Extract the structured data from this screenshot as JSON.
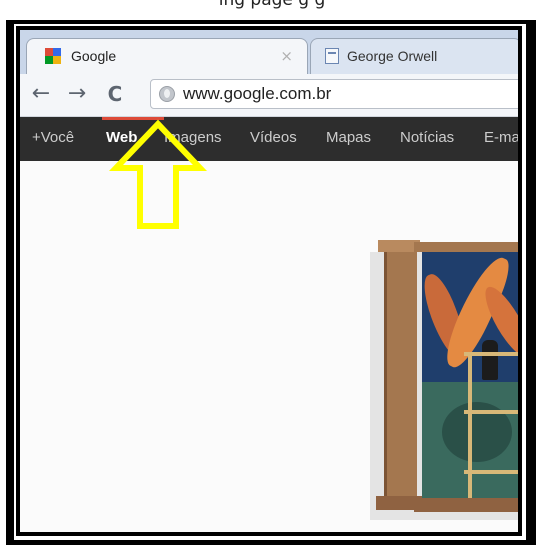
{
  "caption": {
    "text": "ing   page   g   g"
  },
  "browser": {
    "tabs": [
      {
        "title": "Google",
        "active": true,
        "icon": "google-favicon",
        "close": "×"
      },
      {
        "title": "George Orwell",
        "active": false,
        "icon": "document-favicon"
      }
    ],
    "toolbar": {
      "back_icon": "←",
      "forward_icon": "→",
      "reload_icon": "C",
      "url": "www.google.com.br"
    }
  },
  "google_bar": {
    "items": [
      {
        "label": "+Você",
        "active": false
      },
      {
        "label": "Web",
        "active": true
      },
      {
        "label": "Imagens",
        "active": false
      },
      {
        "label": "Vídeos",
        "active": false
      },
      {
        "label": "Mapas",
        "active": false
      },
      {
        "label": "Notícias",
        "active": false
      },
      {
        "label": "E-ma",
        "active": false
      }
    ]
  },
  "annotation": {
    "arrow_color": "#ffff00",
    "direction": "up"
  },
  "colors": {
    "tabstrip": "#c9d6e9",
    "toolbar": "#f4f6f9",
    "gbar": "#2d2d2d",
    "gbar_highlight": "#dd4b39"
  }
}
